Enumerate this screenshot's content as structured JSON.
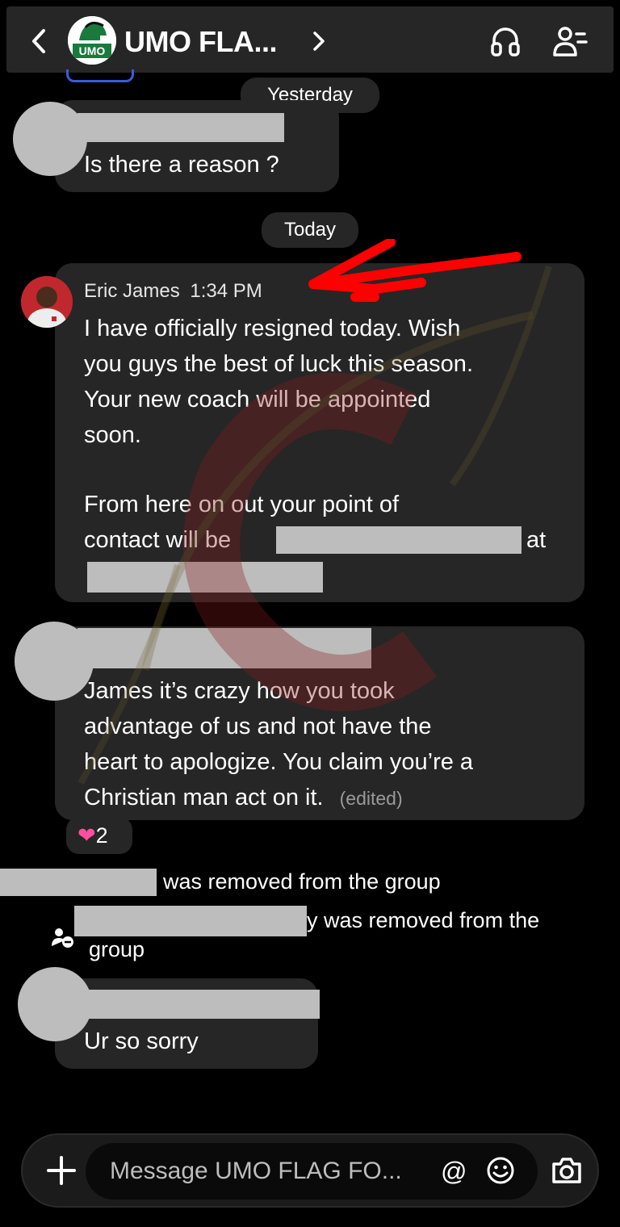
{
  "header": {
    "title": "UMO FLA...",
    "logo_text": "UMO"
  },
  "dates": {
    "yesterday": "Yesterday",
    "today": "Today"
  },
  "messages": {
    "m1": {
      "text": "Is there a reason ?"
    },
    "m2": {
      "sender": "Eric James",
      "time": "1:34 PM",
      "text": "I have officially resigned today. Wish\nyou guys the best of luck this season.\nYour new coach will be appointed\nsoon.",
      "line2a": "From here on out your point of",
      "line2b": "contact will be",
      "line2c": "at"
    },
    "m3": {
      "text": "James it’s crazy how you took\nadvantage of us and not have the\nheart to apologize. You claim you’re a",
      "last_line": "Christian man act on it.",
      "edited": "(edited)"
    },
    "m4": {
      "text": "Ur so sorry"
    }
  },
  "reaction": {
    "count": "2"
  },
  "system": {
    "removed1": "was removed from the group",
    "removed2a": "y was removed from the",
    "removed2b": "group"
  },
  "composer": {
    "placeholder": "Message UMO FLAG FO...",
    "at": "@"
  },
  "colors": {
    "bubble": "#262626",
    "annotation": "#ff0000"
  }
}
